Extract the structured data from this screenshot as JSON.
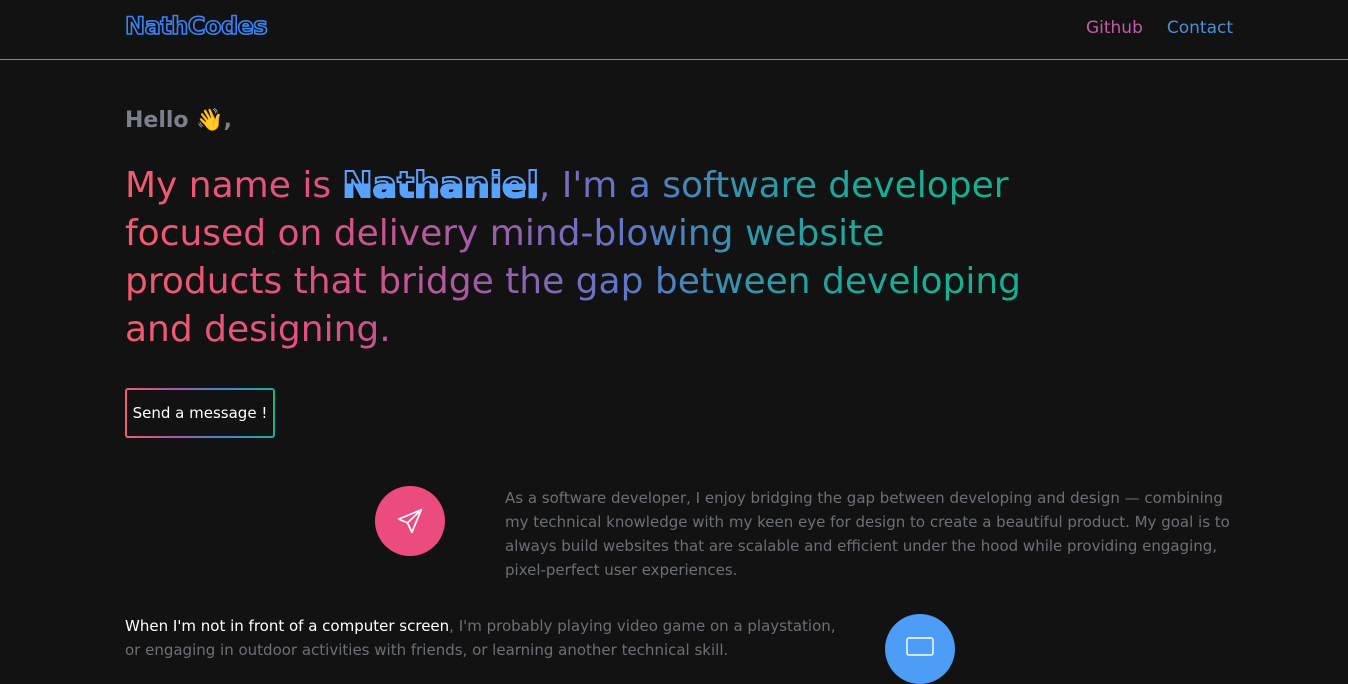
{
  "nav": {
    "logo": "NathCodes",
    "links": [
      {
        "label": "Github"
      },
      {
        "label": "Contact"
      }
    ]
  },
  "hero": {
    "greeting": "Hello",
    "greeting_emoji": "👋",
    "greeting_suffix": ",",
    "headline_pre": "My name is ",
    "name": "Nathaniel",
    "headline_post": ", I'm a software developer focused on delivery mind-blowing website products that bridge the gap between developing and designing.",
    "cta_label": "Send a message !"
  },
  "about": {
    "icon": "paper-plane-icon",
    "text": "As a software developer, I enjoy bridging the gap between developing and design — combining my technical knowledge with my keen eye for design to create a beautiful product. My goal is to always build websites that are scalable and efficient under the hood while providing engaging, pixel-perfect user experiences."
  },
  "hobbies": {
    "icon": "monitor-icon",
    "lead": "When I'm not in front of a computer screen",
    "text": ", I'm probably playing video game on a playstation, or engaging in outdoor activities with friends, or learning another technical skill."
  },
  "colors": {
    "background": "#121212",
    "logo_blue": "#3b82f6",
    "pink_circle": "#ec4b7d",
    "blue_circle": "#4d9cf5"
  }
}
